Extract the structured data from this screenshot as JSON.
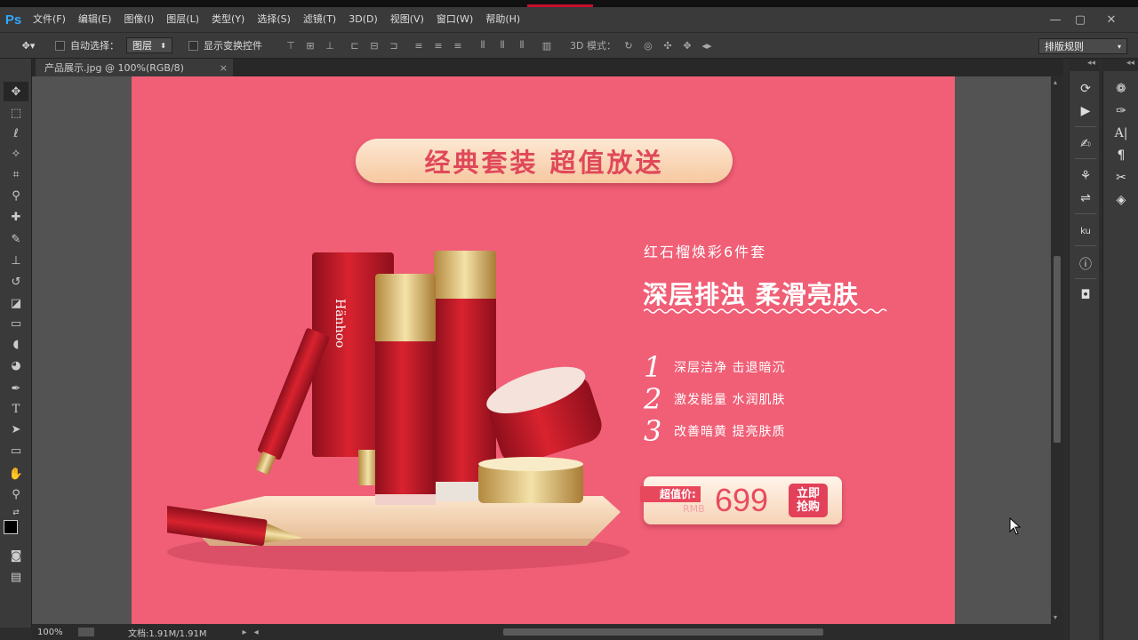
{
  "app": {
    "logo": "Ps"
  },
  "menu": [
    "文件(F)",
    "编辑(E)",
    "图像(I)",
    "图层(L)",
    "类型(Y)",
    "选择(S)",
    "滤镜(T)",
    "3D(D)",
    "视图(V)",
    "窗口(W)",
    "帮助(H)"
  ],
  "window_controls": [
    "minimize-icon",
    "restore-icon",
    "close-icon"
  ],
  "options": {
    "auto_select_label": "自动选择：",
    "auto_select_value": "图层",
    "show_transform_label": "显示变换控件",
    "mode_3d_label": "3D 模式：",
    "workspace_value": "排版规则"
  },
  "document": {
    "tab_title": "产品展示.jpg @ 100%(RGB/8)",
    "close": "×"
  },
  "artwork": {
    "banner": "经典套装 超值放送",
    "subtitle": "红石榴焕彩6件套",
    "headline": "深层排浊 柔滑亮肤",
    "features": [
      {
        "num": "1",
        "text": "深层洁净 击退暗沉"
      },
      {
        "num": "2",
        "text": "激发能量 水润肌肤"
      },
      {
        "num": "3",
        "text": "改善暗黄 提亮肤质"
      }
    ],
    "price_tag": "超值价:",
    "currency": "RMB",
    "price": "699",
    "buy_line1": "立即",
    "buy_line2": "抢购",
    "brand": "Hänhoo"
  },
  "status": {
    "zoom": "100%",
    "doc_size": "文档:1.91M/1.91M"
  },
  "colors": {
    "canvas": "#f05f76",
    "banner_text": "#e0485a",
    "panel": "#3a3a3a",
    "ps_blue": "#31a8ff"
  }
}
